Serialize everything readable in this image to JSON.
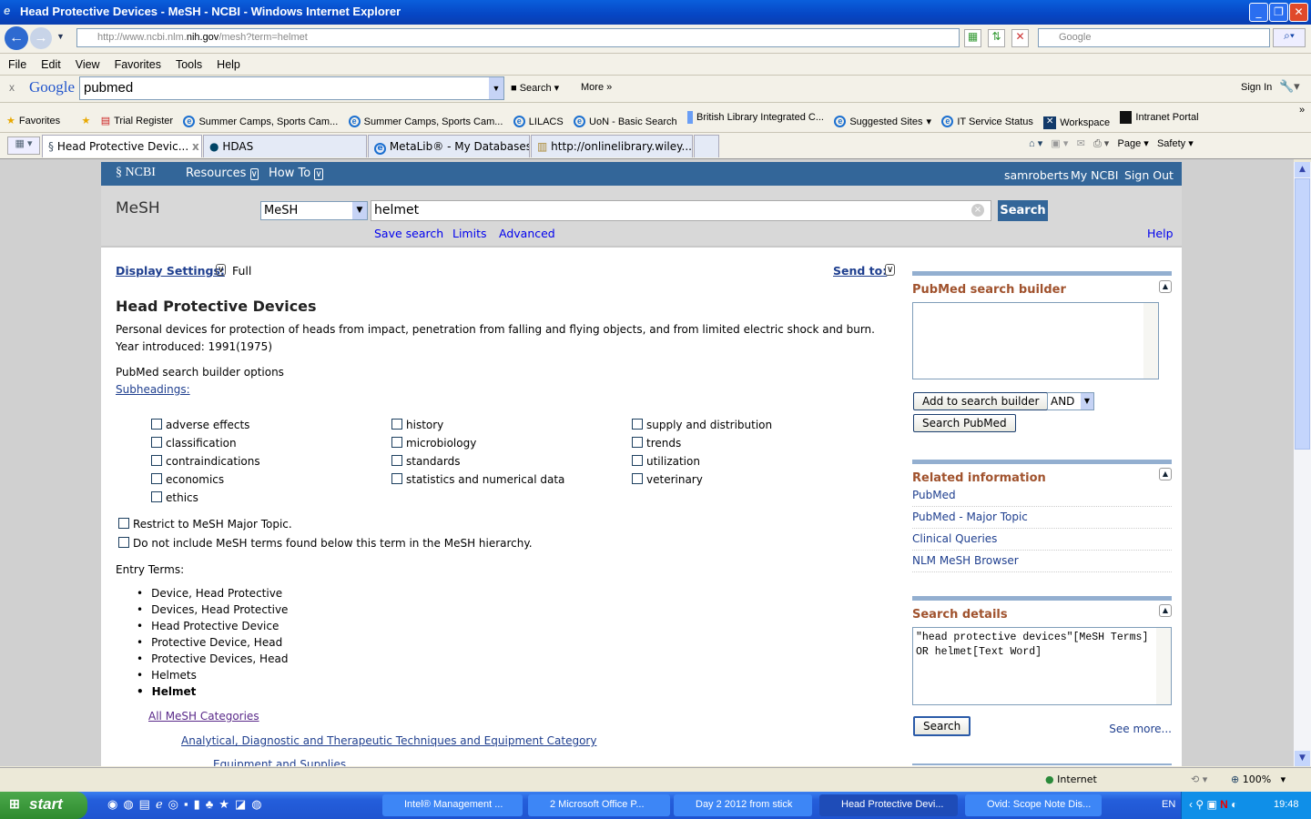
{
  "window": {
    "title": "Head Protective Devices - MeSH - NCBI - Windows Internet Explorer"
  },
  "browser": {
    "url_prefix": "http://www.ncbi.nlm.",
    "url_domain": "nih.gov",
    "url_suffix": "/mesh?term=helmet",
    "search_placeholder": "Google",
    "menu": [
      "File",
      "Edit",
      "View",
      "Favorites",
      "Tools",
      "Help"
    ],
    "google_bar": {
      "logo": "Google",
      "query": "pubmed",
      "search_label": "Search",
      "more_label": "More »",
      "sign_in": "Sign In"
    },
    "favorites_label": "Favorites",
    "favorites": [
      "Trial Register",
      "Summer Camps, Sports Cam...",
      "Summer Camps, Sports Cam...",
      "LILACS",
      "UoN - Basic Search",
      "British Library Integrated C...",
      "Suggested Sites",
      "IT Service Status",
      "Workspace",
      "Intranet Portal"
    ],
    "tabs": [
      "Head Protective Devic...",
      "HDAS",
      "MetaLib® - My Databases",
      "http://onlinelibrary.wiley...."
    ],
    "command_bar": {
      "page": "Page",
      "safety": "Safety"
    }
  },
  "ncbi": {
    "logo": "NCBI",
    "resources": "Resources",
    "howto": "How To",
    "user": "samroberts",
    "my_ncbi": "My NCBI",
    "sign_out": "Sign Out",
    "db_label": "MeSH",
    "db_select": "MeSH",
    "query": "helmet",
    "search_button": "Search",
    "links": [
      "Save search",
      "Limits",
      "Advanced"
    ],
    "help": "Help"
  },
  "content": {
    "display_settings": "Display Settings:",
    "display_value": "Full",
    "send_to": "Send to:",
    "title": "Head Protective Devices",
    "description": "Personal devices for protection of heads from impact, penetration from falling and flying objects, and from limited electric shock and burn.",
    "year": "Year introduced: 1991(1975)",
    "builder_options": "PubMed search builder options",
    "subheadings_label": "Subheadings:",
    "subheadings": [
      "adverse effects",
      "classification",
      "contraindications",
      "economics",
      "ethics",
      "history",
      "microbiology",
      "standards",
      "statistics and numerical data",
      "supply and distribution",
      "trends",
      "utilization",
      "veterinary"
    ],
    "restrict": "Restrict to MeSH Major Topic.",
    "no_explode": "Do not include MeSH terms found below this term in the MeSH hierarchy.",
    "entry_terms_label": "Entry Terms:",
    "entry_terms": [
      "Device, Head Protective",
      "Devices, Head Protective",
      "Head Protective Device",
      "Protective Device, Head",
      "Protective Devices, Head",
      "Helmets",
      "Helmet"
    ],
    "tree": [
      "All MeSH Categories",
      "Analytical, Diagnostic and Therapeutic Techniques and Equipment Category",
      "Equipment and Supplies"
    ]
  },
  "sidebar": {
    "builder_title": "PubMed search builder",
    "builder_text": "",
    "add_button": "Add to search builder",
    "operator": "AND",
    "search_pubmed": "Search PubMed",
    "related_title": "Related information",
    "related": [
      "PubMed",
      "PubMed - Major Topic",
      "Clinical Queries",
      "NLM MeSH Browser"
    ],
    "details_title": "Search details",
    "details_text": "\"head protective devices\"[MeSH Terms] OR helmet[Text Word]",
    "details_search": "Search",
    "see_more": "See more..."
  },
  "statusbar": {
    "zone": "Internet",
    "zoom": "100%"
  },
  "taskbar": {
    "start": "start",
    "tasks": [
      "Intel® Management ...",
      "2 Microsoft Office P...",
      "Day 2 2012 from stick",
      "Head Protective Devi...",
      "Ovid: Scope Note Dis..."
    ],
    "lang": "EN",
    "clock": "19:48"
  }
}
